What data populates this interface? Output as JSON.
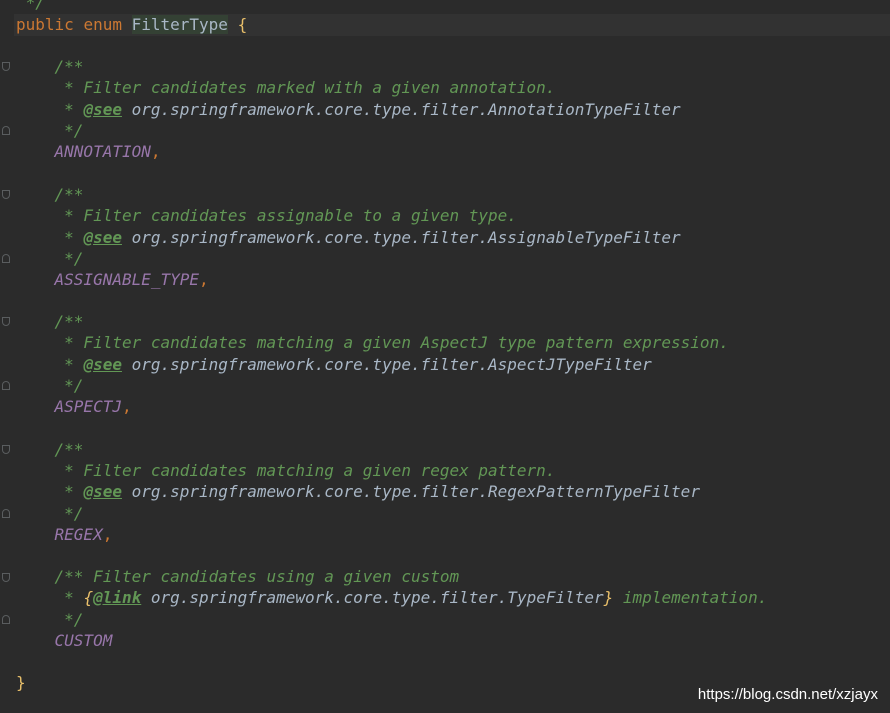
{
  "code": {
    "prev_comment_close": " */",
    "decl": {
      "kw_public": "public",
      "kw_enum": "enum",
      "class_name": "FilterType",
      "brace_open": "{"
    },
    "doc_open": "/**",
    "doc_close": " */",
    "doc_star": " *",
    "see_tag": "@see",
    "link_tag": "@link",
    "comma": ",",
    "entries": [
      {
        "description": " * Filter candidates marked with a given annotation.",
        "see_ref": "org.springframework.core.type.filter.AnnotationTypeFilter",
        "constant": "ANNOTATION"
      },
      {
        "description": " * Filter candidates assignable to a given type.",
        "see_ref": "org.springframework.core.type.filter.AssignableTypeFilter",
        "constant": "ASSIGNABLE_TYPE"
      },
      {
        "description": " * Filter candidates matching a given AspectJ type pattern expression.",
        "see_ref": "org.springframework.core.type.filter.AspectJTypeFilter",
        "constant": "ASPECTJ"
      },
      {
        "description": " * Filter candidates matching a given regex pattern.",
        "see_ref": "org.springframework.core.type.filter.RegexPatternTypeFilter",
        "constant": "REGEX"
      }
    ],
    "custom": {
      "doc_line": "/** Filter candidates using a given custom",
      "link_open": "{",
      "link_ref": "org.springframework.core.type.filter.TypeFilter",
      "link_close": "}",
      "link_tail": " implementation.",
      "constant": "CUSTOM"
    },
    "brace_close": "}"
  },
  "watermark": "https://blog.csdn.net/xzjayx",
  "colors": {
    "background": "#2b2b2b",
    "keyword": "#cc7832",
    "doc_comment": "#629755",
    "enum_constant": "#9876aa",
    "plain": "#a9b7c6",
    "brace": "#e8bf6a"
  }
}
